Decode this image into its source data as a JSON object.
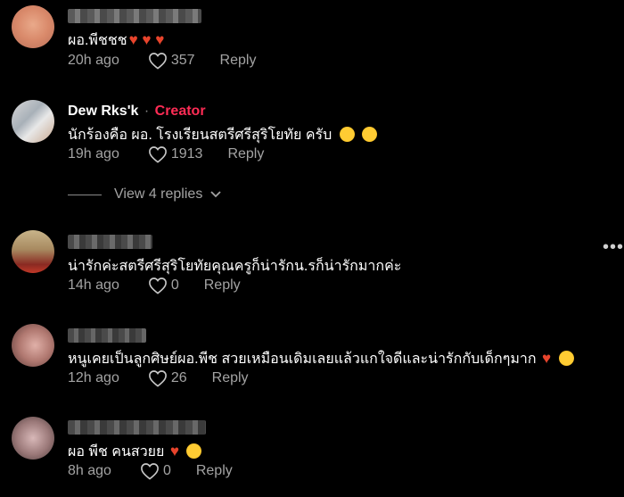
{
  "comments": [
    {
      "text": "ผอ.พีชชช",
      "emojis_after": "♥ ♥ ♥",
      "time": "20h ago",
      "likes": "357",
      "reply": "Reply"
    },
    {
      "author": "Dew Rks'k",
      "separator": "·",
      "badge": "Creator",
      "text": "นักร้องคือ ผอ. โรงเรียนสตรีศรีสุริโยทัย ครับ",
      "time": "19h ago",
      "likes": "1913",
      "reply": "Reply"
    },
    {
      "text": "น่ารักค่ะสตรีศรีสุริโยทัยคุณครูก็น่ารักน.รก็น่ารักมากค่ะ",
      "time": "14h ago",
      "likes": "0",
      "reply": "Reply"
    },
    {
      "text": "หนูเคยเป็นลูกศิษย์ผอ.พีช สวยเหมือนเดิมเลยแล้วแกใจดีและน่ารักกับเด็กๆมาก",
      "time": "12h ago",
      "likes": "26",
      "reply": "Reply"
    },
    {
      "text": "ผอ พีช คนสวยย",
      "time": "8h ago",
      "likes": "0",
      "reply": "Reply"
    }
  ],
  "view_replies": "View 4 replies",
  "colors": {
    "background": "#000000",
    "creator": "#fe2c55",
    "muted": "#a3a3a3",
    "heart": "#e8442c"
  }
}
